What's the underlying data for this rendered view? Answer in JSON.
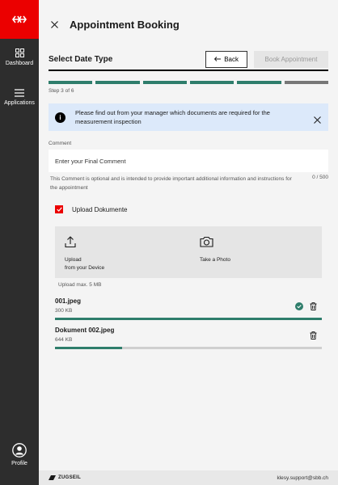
{
  "sidebar": {
    "logo_icon": "sbb-arrow-logo",
    "items": [
      {
        "label": "Dashboard",
        "icon": "grid-icon"
      },
      {
        "label": "Applications",
        "icon": "menu-icon"
      }
    ],
    "profile_label": "Profile",
    "brand_color": "#eb0000"
  },
  "header": {
    "title": "Appointment Booking"
  },
  "step": {
    "title": "Select Date Type",
    "back_label": "Back",
    "book_label": "Book Appointment",
    "count_text": "Step 3 of 6",
    "current": 3,
    "total": 6
  },
  "info": {
    "text": "Please find out from your manager which documents are required for the measurement inspection"
  },
  "comment": {
    "label": "Comment",
    "placeholder": "Enter your Final Comment",
    "help": "This Comment is optional and is intended to provide important additional information and instructions for the appointment",
    "counter": "0 / 500"
  },
  "upload": {
    "checkbox_label": "Upload Dokumente",
    "checked": true,
    "device_label_1": "Upload",
    "device_label_2": "from your Device",
    "photo_label": "Take a Photo",
    "max_text": "Upload max. 5 MB"
  },
  "files": [
    {
      "name": "001.jpeg",
      "size": "300 KB",
      "progress": 1.0,
      "done": true
    },
    {
      "name": "Dokument 002.jpeg",
      "size": "644 KB",
      "progress": 0.25,
      "done": false
    }
  ],
  "footer": {
    "brand": "ZUGSEIL",
    "email": "klesy.support@sbb.ch"
  },
  "colors": {
    "accent": "#2e7d6b",
    "brand_red": "#eb0000",
    "info_bg": "#dce9fa"
  }
}
